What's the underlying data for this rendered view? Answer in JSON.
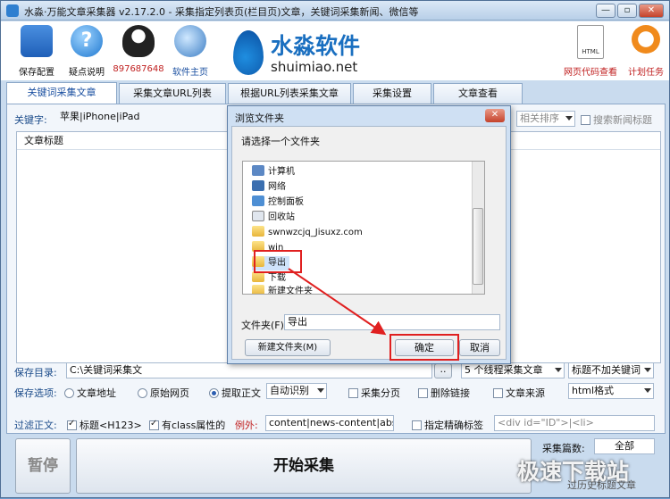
{
  "window": {
    "title": "水淼·万能文章采集器 v2.17.2.0 - 采集指定列表页(栏目页)文章，关键词采集新闻、微信等",
    "controls": {
      "minimize": "—",
      "maximize": "▫",
      "close": "✕"
    }
  },
  "toolbar": {
    "items": [
      {
        "label": "保存配置",
        "icon": "floppy-disk-icon"
      },
      {
        "label": "疑点说明",
        "icon": "help-icon"
      },
      {
        "label": "897687648",
        "icon": "qq-penguin-icon"
      },
      {
        "label": "软件主页",
        "icon": "globe-icon"
      }
    ],
    "right_items": [
      {
        "label": "网页代码查看",
        "icon": "html-file-icon"
      },
      {
        "label": "计划任务",
        "icon": "clock-icon"
      }
    ]
  },
  "logo": {
    "cn": "水淼软件",
    "en": "shuimiao.net"
  },
  "tabs": [
    "关键词采集文章",
    "采集文章URL列表",
    "根据URL列表采集文章",
    "采集设置",
    "文章查看"
  ],
  "main": {
    "keyword_label": "关键字:",
    "keyword_value": "苹果|iPhone|iPad",
    "sort_label": "相关排序",
    "search_news_title": "搜索新闻标题",
    "list_header": "文章标题",
    "save_dir_label": "保存目录:",
    "save_dir_value": "C:\\关键词采集文",
    "browse_button": "..",
    "threads_option": "5 个线程采集文章",
    "title_option": "标题不加关键词",
    "save_options_label": "保存选项:",
    "radio_article_url": "文章地址",
    "radio_original_page": "原始网页",
    "radio_extract_body": "提取正文",
    "auto_detect": "自动识别",
    "cb_paginate": "采集分页",
    "cb_remove_links": "删除链接",
    "cb_article_source": "文章来源",
    "format_option": "html格式",
    "filter_label": "过滤正文:",
    "cb_title_h123": "标题<H123>",
    "cb_class_attr": "有class属性的",
    "exception_label": "例外:",
    "exception_value": "content|news-content|abs",
    "cb_precise_tag": "指定精确标签",
    "tag_value": "<div id=\"ID\">|<li>",
    "pause_button": "暂停",
    "start_button": "开始采集",
    "count_label": "采集篇数:",
    "count_value": "全部",
    "history_label": "过历史标题文章",
    "watermark": "极速下载站"
  },
  "dialog": {
    "title": "浏览文件夹",
    "prompt": "请选择一个文件夹",
    "tree": [
      "计算机",
      "网络",
      "控制面板",
      "回收站",
      "swnwzcjq_Jisuxz.com",
      "win",
      "导出",
      "下载",
      "新建文件夹"
    ],
    "folder_label": "文件夹(F):",
    "folder_value": "导出",
    "new_folder_button": "新建文件夹(M)",
    "ok_button": "确定",
    "cancel_button": "取消"
  }
}
